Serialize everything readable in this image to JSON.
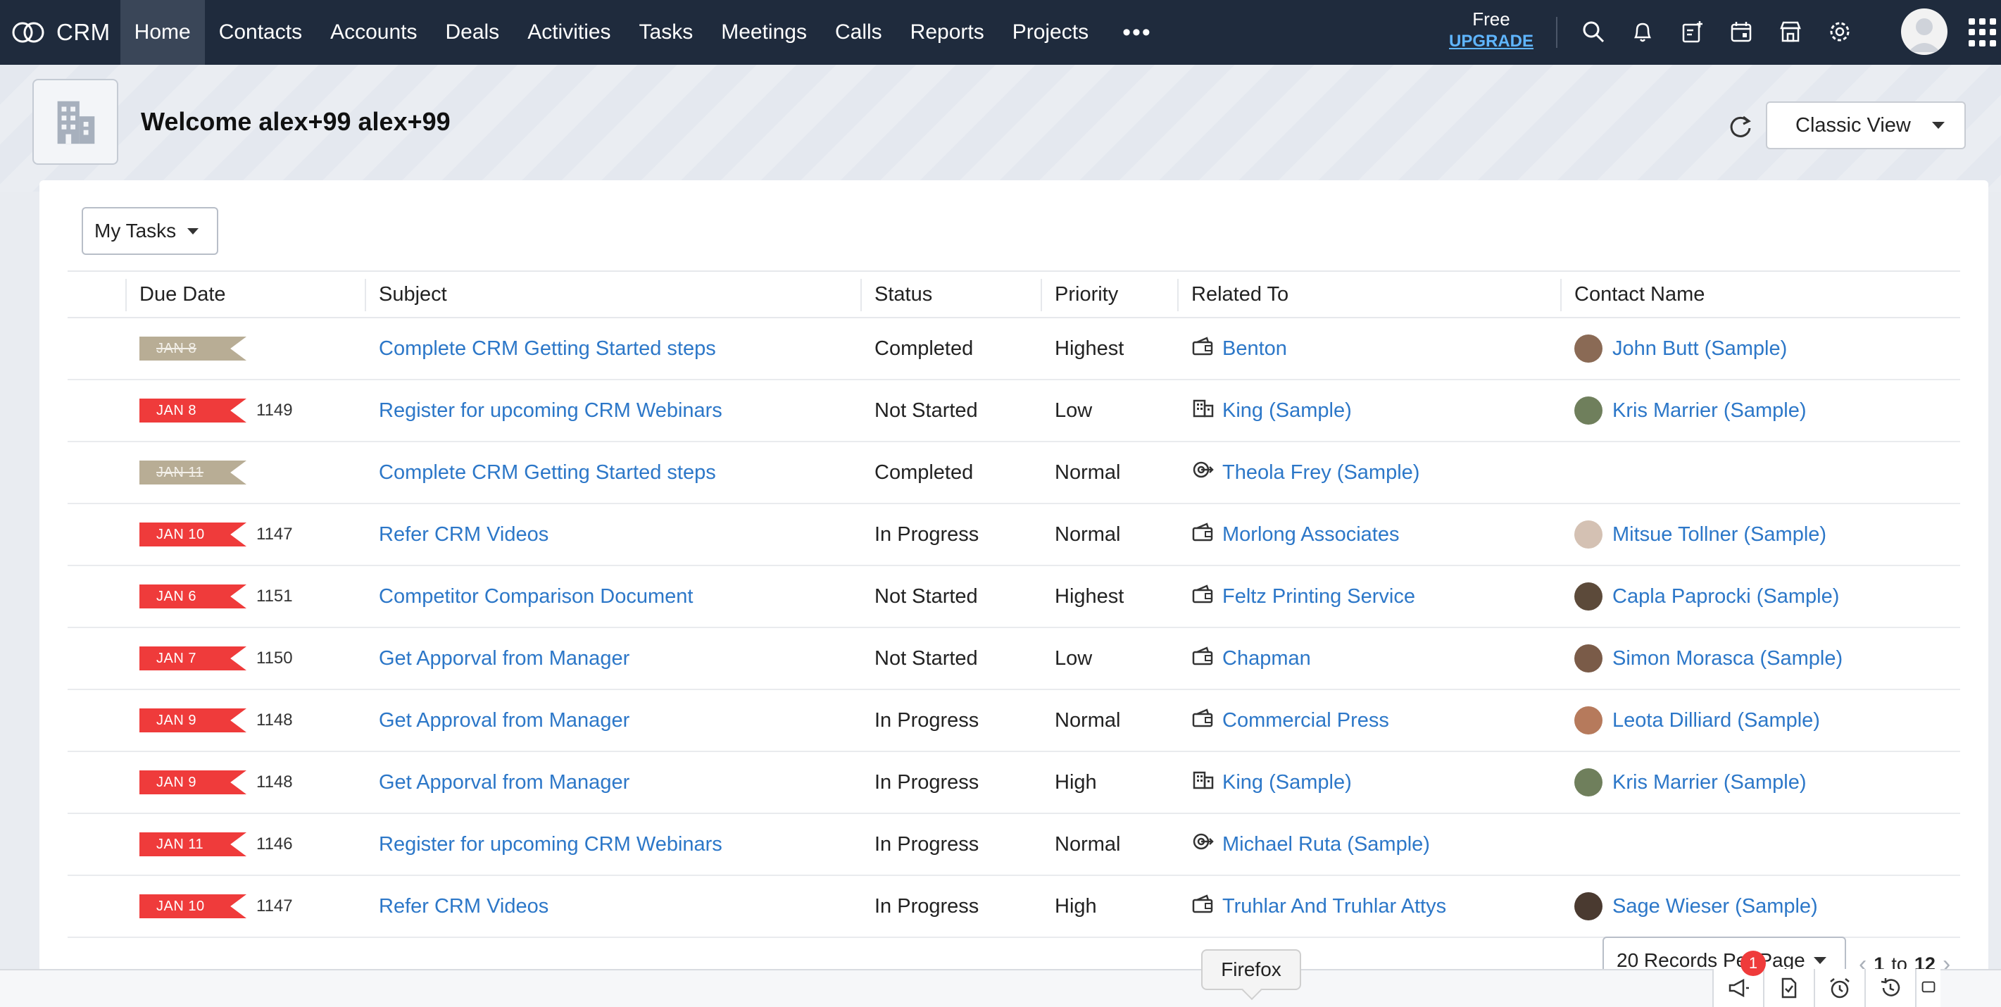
{
  "app": {
    "name": "CRM"
  },
  "nav": {
    "items": [
      {
        "label": "Home",
        "active": true
      },
      {
        "label": "Contacts"
      },
      {
        "label": "Accounts"
      },
      {
        "label": "Deals"
      },
      {
        "label": "Activities"
      },
      {
        "label": "Tasks"
      },
      {
        "label": "Meetings"
      },
      {
        "label": "Calls"
      },
      {
        "label": "Reports"
      },
      {
        "label": "Projects"
      }
    ],
    "more": "•••"
  },
  "plan": {
    "free": "Free",
    "upgrade": "UPGRADE"
  },
  "header": {
    "welcome": "Welcome alex+99 alex+99",
    "view": "Classic View"
  },
  "filter": {
    "label": "My Tasks"
  },
  "table": {
    "columns": [
      "Due Date",
      "Subject",
      "Status",
      "Priority",
      "Related To",
      "Contact Name"
    ],
    "rows": [
      {
        "due": "JAN 8",
        "done": true,
        "num": "",
        "subject": "Complete CRM Getting Started steps",
        "status": "Completed",
        "priority": "Highest",
        "related_icon": "deal-icon",
        "related": "Benton",
        "contact": "John Butt (Sample)",
        "avatar": "#8a6a55"
      },
      {
        "due": "JAN 8",
        "done": false,
        "num": "1149",
        "subject": "Register for upcoming CRM Webinars",
        "status": "Not Started",
        "priority": "Low",
        "related_icon": "account-icon",
        "related": "King (Sample)",
        "contact": "Kris Marrier (Sample)",
        "avatar": "#6f7f5c"
      },
      {
        "due": "JAN 11",
        "done": true,
        "num": "",
        "subject": "Complete CRM Getting Started steps",
        "status": "Completed",
        "priority": "Normal",
        "related_icon": "lead-icon",
        "related": "Theola Frey (Sample)",
        "contact": "",
        "avatar": ""
      },
      {
        "due": "JAN 10",
        "done": false,
        "num": "1147",
        "subject": "Refer CRM Videos",
        "status": "In Progress",
        "priority": "Normal",
        "related_icon": "deal-icon",
        "related": "Morlong Associates",
        "contact": "Mitsue Tollner (Sample)",
        "avatar": "#d4c1b3"
      },
      {
        "due": "JAN 6",
        "done": false,
        "num": "1151",
        "subject": "Competitor Comparison Document",
        "status": "Not Started",
        "priority": "Highest",
        "related_icon": "deal-icon",
        "related": "Feltz Printing Service",
        "contact": "Capla Paprocki (Sample)",
        "avatar": "#5c4a3a"
      },
      {
        "due": "JAN 7",
        "done": false,
        "num": "1150",
        "subject": "Get Apporval from Manager",
        "status": "Not Started",
        "priority": "Low",
        "related_icon": "deal-icon",
        "related": "Chapman",
        "contact": "Simon Morasca (Sample)",
        "avatar": "#7a5b48"
      },
      {
        "due": "JAN 9",
        "done": false,
        "num": "1148",
        "subject": "Get Approval from Manager",
        "status": "In Progress",
        "priority": "Normal",
        "related_icon": "deal-icon",
        "related": "Commercial Press",
        "contact": "Leota Dilliard (Sample)",
        "avatar": "#b67a5c"
      },
      {
        "due": "JAN 9",
        "done": false,
        "num": "1148",
        "subject": "Get Apporval from Manager",
        "status": "In Progress",
        "priority": "High",
        "related_icon": "account-icon",
        "related": "King (Sample)",
        "contact": "Kris Marrier (Sample)",
        "avatar": "#6f7f5c"
      },
      {
        "due": "JAN 11",
        "done": false,
        "num": "1146",
        "subject": "Register for upcoming CRM Webinars",
        "status": "In Progress",
        "priority": "Normal",
        "related_icon": "lead-icon",
        "related": "Michael Ruta (Sample)",
        "contact": "",
        "avatar": ""
      },
      {
        "due": "JAN 10",
        "done": false,
        "num": "1147",
        "subject": "Refer CRM Videos",
        "status": "In Progress",
        "priority": "High",
        "related_icon": "deal-icon",
        "related": "Truhlar And Truhlar Attys",
        "contact": "Sage Wieser (Sample)",
        "avatar": "#4a3a30"
      }
    ]
  },
  "pagination": {
    "per_page": "20 Records Per Page",
    "range_start": "1",
    "range_to": "to",
    "range_end": "12"
  },
  "tooltip": {
    "label": "Firefox"
  },
  "notifications": {
    "badge": "1"
  },
  "colors": {
    "nav_bg": "#1f2b3d",
    "link": "#2c77c8",
    "overdue": "#ef3b3b",
    "done": "#b8ad95"
  }
}
